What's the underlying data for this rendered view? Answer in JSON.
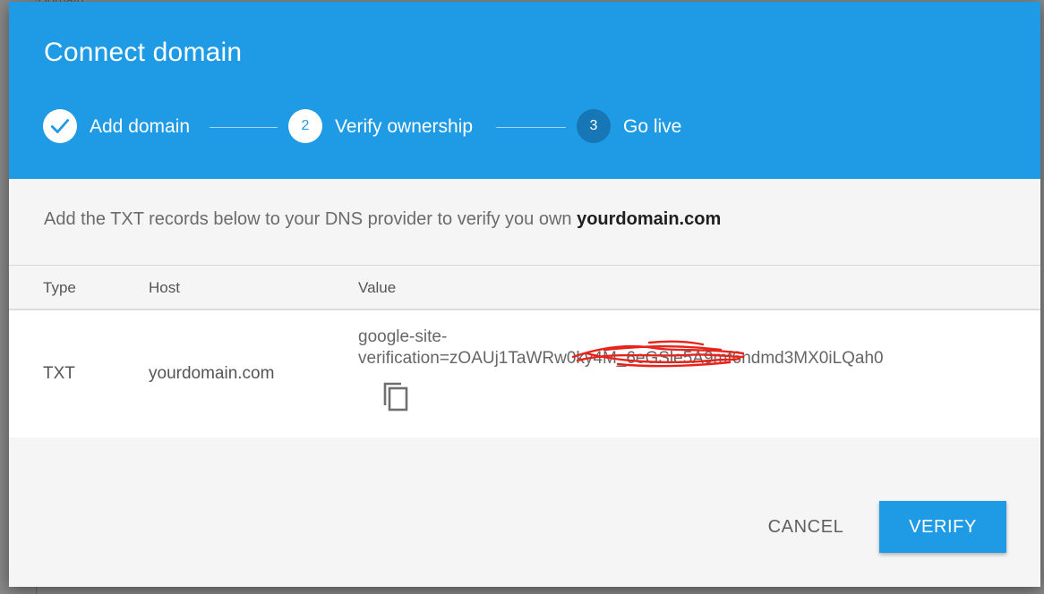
{
  "background": {
    "label": "Domain"
  },
  "dialog": {
    "title": "Connect domain",
    "steps": [
      {
        "number": "",
        "label": "Add domain",
        "state": "done"
      },
      {
        "number": "2",
        "label": "Verify ownership",
        "state": "active"
      },
      {
        "number": "3",
        "label": "Go live",
        "state": "todo"
      }
    ],
    "intro_text": "Add the TXT records below to your DNS provider to verify you own ",
    "intro_domain": "yourdomain.com",
    "table": {
      "columns": [
        "Type",
        "Host",
        "Value"
      ],
      "rows": [
        {
          "type": "TXT",
          "host": "yourdomain.com",
          "value_line1": "google-site-",
          "value_line2": "verification=zOAUj1TaWRw0ky4M_6eGSle5A9mf6ndmd3MX0iLQah0"
        }
      ]
    },
    "cancel_label": "CANCEL",
    "verify_label": "VERIFY"
  },
  "colors": {
    "header": "#1e9be4",
    "step_todo": "#1776b6",
    "verify_button": "#1e9be4",
    "redaction": "#e8231c"
  },
  "icons": {
    "step_done": "check-icon",
    "copy": "copy-icon"
  }
}
